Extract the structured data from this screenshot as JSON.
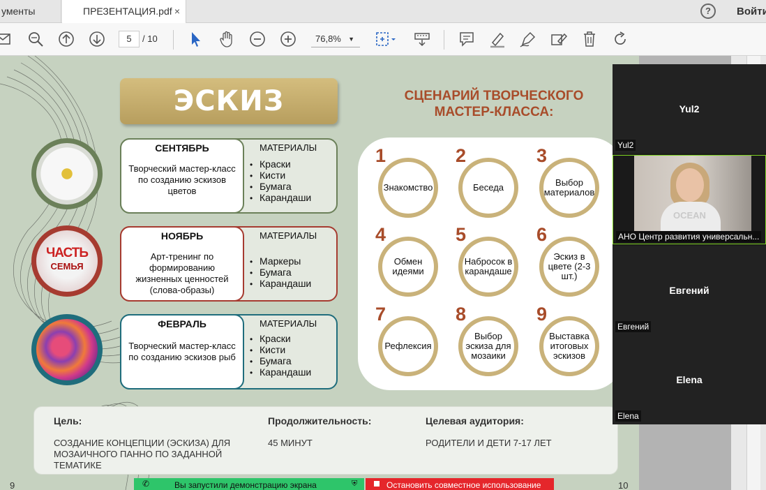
{
  "tabs": [
    {
      "label": "ументы"
    },
    {
      "label": "ПРЕЗЕНТАЦИЯ.pdf",
      "close": "×"
    }
  ],
  "header": {
    "help": "?",
    "signin": "Войти"
  },
  "toolbar": {
    "page_current": "5",
    "page_total": "/ 10",
    "zoom": "76,8%"
  },
  "slide": {
    "title": "ЭСКИЗ",
    "scenario_title": "СЦЕНАРИЙ ТВОРЧЕСКОГО МАСТЕР-КЛАССА:",
    "materials_label": "МАТЕРИАЛЫ",
    "months": [
      {
        "name": "СЕНТЯБРЬ",
        "desc": "Творческий мастер-класс по созданию эскизов цветов",
        "materials": [
          "Краски",
          "Кисти",
          "Бумага",
          "Карандаши"
        ],
        "color": "#6b8059"
      },
      {
        "name": "НОЯБРЬ",
        "desc": "Арт-тренинг по формированию жизненных ценностей (слова-образы)",
        "materials": [
          "Маркеры",
          "Бумага",
          "Карандаши"
        ],
        "color": "#a63b30"
      },
      {
        "name": "ФЕВРАЛЬ",
        "desc": "Творческий мастер-класс по созданию эскизов рыб",
        "materials": [
          "Краски",
          "Кисти",
          "Бумага",
          "Карандаши"
        ],
        "color": "#1f6d7c"
      }
    ],
    "steps": [
      {
        "num": "1",
        "label": "Знакомство"
      },
      {
        "num": "2",
        "label": "Беседа"
      },
      {
        "num": "3",
        "label": "Выбор материалов"
      },
      {
        "num": "4",
        "label": "Обмен идеями"
      },
      {
        "num": "5",
        "label": "Набросок в карандаше"
      },
      {
        "num": "6",
        "label": "Эскиз в цвете (2-3 шт.)"
      },
      {
        "num": "7",
        "label": "Рефлексия"
      },
      {
        "num": "8",
        "label": "Выбор эскиза для мозаики"
      },
      {
        "num": "9",
        "label": "Выставка итоговых эскизов"
      }
    ],
    "goal_label": "Цель:",
    "goal": "СОЗДАНИЕ КОНЦЕПЦИИ (ЭСКИЗА) ДЛЯ МОЗАИЧНОГО ПАННО ПО ЗАДАННОЙ ТЕМАТИКЕ",
    "duration_label": "Продолжительность:",
    "duration": "45 МИНУТ",
    "audience_label": "Целевая аудитория:",
    "audience": "РОДИТЕЛИ И ДЕТИ 7-17 ЛЕТ",
    "page_left": "9",
    "page_right": "10"
  },
  "share": {
    "active": "Вы запустили демонстрацию экрана",
    "stop": "Остановить совместное использование"
  },
  "participants": [
    {
      "name": "Yul2",
      "tag": "Yul2"
    },
    {
      "name": "",
      "tag": "АНО Центр развития универсальн..."
    },
    {
      "name": "Евгений",
      "tag": "Евгений"
    },
    {
      "name": "Elena",
      "tag": "Elena"
    }
  ],
  "medal_texts": [
    "ЧАСТЬ",
    "СЕМЬЯ"
  ],
  "video_text": "OCEAN"
}
